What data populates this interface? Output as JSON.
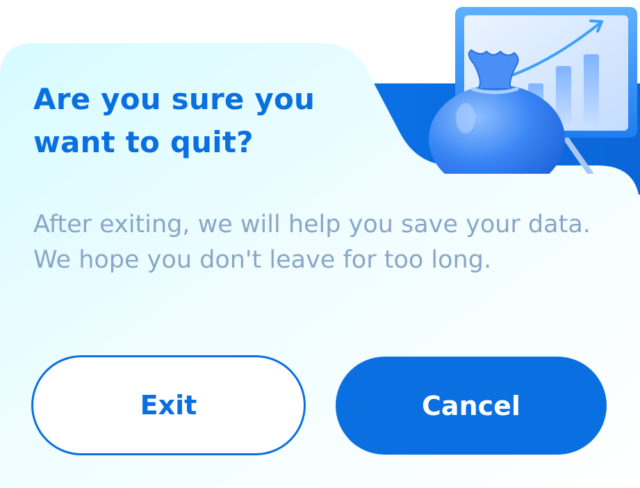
{
  "dialog": {
    "title": "Are you sure you want to quit?",
    "message": "After exiting, we will help you save your data. We hope you don't leave for too long.",
    "exit_label": "Exit",
    "cancel_label": "Cancel"
  },
  "illustration": {
    "icon": "money-bag-growth-chart-icon"
  },
  "colors": {
    "accent": "#0a6fe0",
    "title": "#0a6fe0",
    "message": "#8aa6c6",
    "background_tint": "#dcfbff"
  }
}
